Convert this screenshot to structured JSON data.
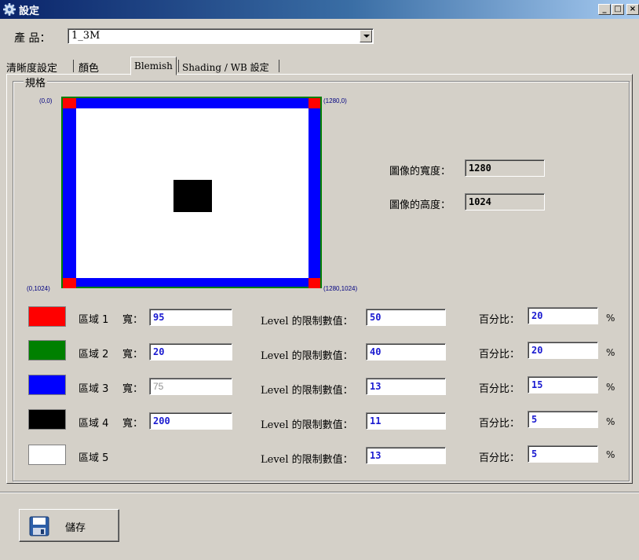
{
  "window": {
    "title": "設定",
    "minimize": "_",
    "maximize": "□",
    "close": "×"
  },
  "product": {
    "label": "產 品：",
    "value": "1_3M"
  },
  "tabs": [
    {
      "label": "清晰度設定"
    },
    {
      "label": "顏色"
    },
    {
      "label": "Blemish",
      "active": true
    },
    {
      "label": "Shading / WB 設定"
    }
  ],
  "group": {
    "title": "規格"
  },
  "diagram": {
    "top_left": "(0,0)",
    "top_right": "(1280,0)",
    "bottom_left": "(0,1024)",
    "bottom_right": "(1280,1024)"
  },
  "image": {
    "width_label": "圖像的寬度：",
    "width_value": "1280",
    "height_label": "圖像的高度：",
    "height_value": "1024"
  },
  "regions": [
    {
      "color": "#ff0000",
      "label": "區域 1",
      "width_label": "寬：",
      "width": "95",
      "level_label": "Level 的限制數值：",
      "level": "50",
      "pct_label": "百分比：",
      "pct": "20",
      "unit": "%"
    },
    {
      "color": "#008000",
      "label": "區域 2",
      "width_label": "寬：",
      "width": "20",
      "level_label": "Level 的限制數值：",
      "level": "40",
      "pct_label": "百分比：",
      "pct": "20",
      "unit": "%"
    },
    {
      "color": "#0000ff",
      "label": "區域 3",
      "width_label": "寬：",
      "width": "75",
      "width_disabled": true,
      "level_label": "Level 的限制數值：",
      "level": "13",
      "pct_label": "百分比：",
      "pct": "15",
      "unit": "%"
    },
    {
      "color": "#000000",
      "label": "區域 4",
      "width_label": "寬：",
      "width": "200",
      "level_label": "Level 的限制數值：",
      "level": "11",
      "pct_label": "百分比：",
      "pct": "5",
      "unit": "%"
    },
    {
      "color": "#ffffff",
      "label": "區域 5",
      "level_label": "Level 的限制數值：",
      "level": "13",
      "pct_label": "百分比：",
      "pct": "5",
      "unit": "%"
    }
  ],
  "save": {
    "label": "儲存",
    "icon": "floppy-disk-icon"
  }
}
